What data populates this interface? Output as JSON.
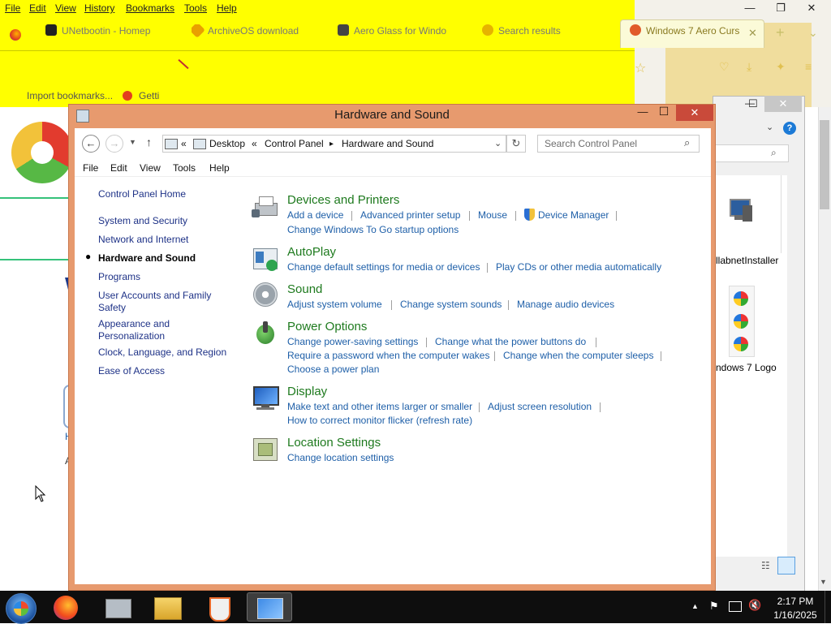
{
  "firefox": {
    "menu": [
      "File",
      "Edit",
      "View",
      "History",
      "Bookmarks",
      "Tools",
      "Help"
    ],
    "tabs": [
      {
        "label": "UNetbootin - Homep",
        "color": "#1a1a1a"
      },
      {
        "label": "ArchiveOS download",
        "color": "#d98a00"
      },
      {
        "label": "Aero Glass for Windo",
        "color": "#333333"
      },
      {
        "label": "Search results",
        "color": "#d9a000"
      },
      {
        "label": "Windows 7 Aero Curs",
        "color": "#d34a1a"
      }
    ],
    "bookmarks": [
      "Import bookmarks...",
      "Getti"
    ],
    "window_controls": {
      "minimize": "—",
      "maximize": "❐",
      "close": "✕"
    }
  },
  "explorer": {
    "items": [
      {
        "label": "llabnetInstaller",
        "icon": "computer-icon"
      },
      {
        "label": "ndows 7 Logo",
        "icon": "windows-logo-icon"
      }
    ],
    "window_controls": {
      "minimize": "—",
      "maximize": "☐",
      "close": "✕"
    }
  },
  "control_panel": {
    "title": "Hardware and Sound",
    "window_controls": {
      "minimize": "—",
      "maximize": "☐",
      "close": "✕"
    },
    "breadcrumb": [
      "Desktop",
      "Control Panel",
      "Hardware and Sound"
    ],
    "breadcrumb_prefix": "«",
    "search_placeholder": "Search Control Panel",
    "menu": [
      "File",
      "Edit",
      "View",
      "Tools",
      "Help"
    ],
    "sidebar": [
      {
        "label": "Control Panel Home",
        "current": false
      },
      {
        "label": "System and Security",
        "current": false
      },
      {
        "label": "Network and Internet",
        "current": false
      },
      {
        "label": "Hardware and Sound",
        "current": true
      },
      {
        "label": "Programs",
        "current": false
      },
      {
        "label": "User Accounts and Family Safety",
        "current": false
      },
      {
        "label": "Appearance and Personalization",
        "current": false
      },
      {
        "label": "Clock, Language, and Region",
        "current": false
      },
      {
        "label": "Ease of Access",
        "current": false
      }
    ],
    "categories": [
      {
        "title": "Devices and Printers",
        "icon": "printer-icon",
        "links": [
          [
            "Add a device",
            "Advanced printer setup",
            "Mouse",
            "Device Manager"
          ],
          [
            "Change Windows To Go startup options"
          ]
        ]
      },
      {
        "title": "AutoPlay",
        "icon": "autoplay-icon",
        "links": [
          [
            "Change default settings for media or devices",
            "Play CDs or other media automatically"
          ]
        ]
      },
      {
        "title": "Sound",
        "icon": "speaker-icon",
        "links": [
          [
            "Adjust system volume",
            "Change system sounds",
            "Manage audio devices"
          ]
        ]
      },
      {
        "title": "Power Options",
        "icon": "battery-icon",
        "links": [
          [
            "Change power-saving settings",
            "Change what the power buttons do"
          ],
          [
            "Require a password when the computer wakes",
            "Change when the computer sleeps"
          ],
          [
            "Choose a power plan"
          ]
        ]
      },
      {
        "title": "Display",
        "icon": "monitor-icon",
        "links": [
          [
            "Make text and other items larger or smaller",
            "Adjust screen resolution"
          ],
          [
            "How to correct monitor flicker (refresh rate)"
          ]
        ]
      },
      {
        "title": "Location Settings",
        "icon": "location-icon",
        "links": [
          [
            "Change location settings"
          ]
        ]
      }
    ]
  },
  "taskbar": {
    "apps": [
      "firefox-icon",
      "scanner-icon",
      "file-explorer-icon",
      "java-icon",
      "control-panel-icon"
    ],
    "time": "2:17 PM",
    "date": "1/16/2025"
  },
  "colors": {
    "firefox_toolbar": "#ffff00",
    "window_frame": "#e79a6e",
    "close_button": "#c94a3a",
    "link": "#1e5fa8",
    "category_title": "#1e7a1e"
  }
}
